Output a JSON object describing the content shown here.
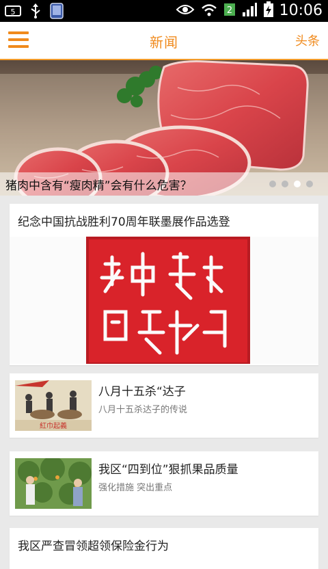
{
  "status_bar": {
    "notification_count": "5",
    "time": "10:06",
    "icons": [
      "notification-icon",
      "usb-icon",
      "phone-icon",
      "eye-icon",
      "wifi-icon",
      "sim-2-icon",
      "signal-icon",
      "battery-charging-icon"
    ],
    "sim_badge": "2"
  },
  "header": {
    "title": "新闻",
    "right_label": "头条",
    "accent": "#f08a1c"
  },
  "hero": {
    "caption": "猪肉中含有“瘦肉精”会有什么危害？",
    "dots_total": 4,
    "active_dot_index": 2
  },
  "featured": {
    "title": "纪念中国抗战胜利70周年联墨展作品选登",
    "seal_color": "#d9232a"
  },
  "news": [
    {
      "title": "八月十五杀“达子",
      "subtitle": "八月十五杀达子的传说"
    },
    {
      "title": "我区“四到位”狠抓果品质量",
      "subtitle": "强化措施 突出重点"
    }
  ],
  "bottom_card": {
    "title": "我区严查冒领超领保险金行为"
  }
}
